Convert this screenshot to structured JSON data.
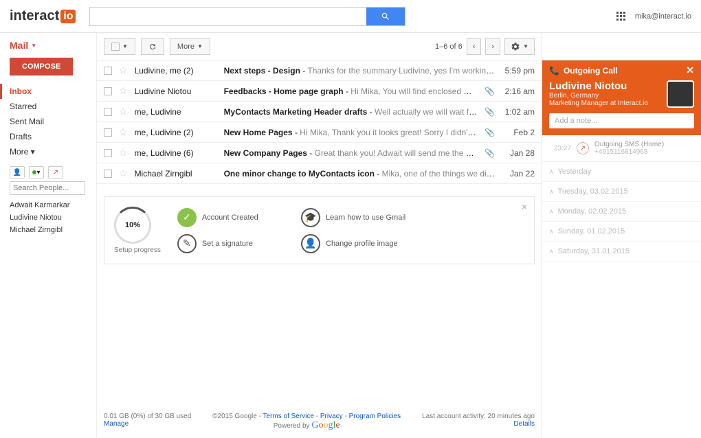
{
  "logo": {
    "prefix": "interact",
    "suffix": "io"
  },
  "user_email": "mika@interact.io",
  "mail_label": "Mail",
  "compose": "COMPOSE",
  "nav": [
    {
      "label": "Inbox",
      "active": true
    },
    {
      "label": "Starred"
    },
    {
      "label": "Sent Mail"
    },
    {
      "label": "Drafts"
    },
    {
      "label": "More"
    }
  ],
  "search_people_placeholder": "Search People...",
  "people": [
    "Adwait Karmarkar",
    "Ludivine Niotou",
    "Michael Zirngibl"
  ],
  "toolbar": {
    "more": "More"
  },
  "page_info": "1–6 of 6",
  "emails": [
    {
      "sender": "Ludivine, me (2)",
      "subject": "Next steps - Design",
      "preview": "Thanks for the summary Ludivine, yes I'm working on the n",
      "time": "5:59 pm"
    },
    {
      "sender": "Ludivine Niotou",
      "subject": "Feedbacks - Home page graph",
      "preview": "Hi Mika, You will find enclosed Michael feedbac",
      "time": "2:16 am",
      "attach": true
    },
    {
      "sender": "me, Ludivine",
      "subject": "MyContacts Marketing Header drafts",
      "preview": "Well actually we will wait for you to finish it",
      "time": "1:02 am",
      "attach": true
    },
    {
      "sender": "me, Ludivine (2)",
      "subject": "New Home Pages",
      "preview": "Hi Mika, Thank you it looks great! Sorry I didn't answer befor",
      "time": "Feb 2",
      "attach": true
    },
    {
      "sender": "me, Ludivine (6)",
      "subject": "New Company Pages",
      "preview": "Great thank you! Adwait will send me the website with all",
      "time": "Jan 28",
      "attach": true
    },
    {
      "sender": "Michael Zirngibl",
      "subject": "One minor change to MyContacts icon",
      "preview": "Mika, one of the things we did in the orig",
      "time": "Jan 22"
    }
  ],
  "onboard": {
    "progress": "10%",
    "progress_label": "Setup progress",
    "items": [
      {
        "icon": "check",
        "label": "Account Created",
        "done": true
      },
      {
        "icon": "grad",
        "label": "Learn how to use Gmail"
      },
      {
        "icon": "pen",
        "label": "Set a signature"
      },
      {
        "icon": "person",
        "label": "Change profile image"
      }
    ]
  },
  "footer": {
    "storage": "0.01 GB (0%) of 30 GB used",
    "manage": "Manage",
    "copyright": "©2015 Google",
    "tos": "Terms of Service",
    "privacy": "Privacy",
    "program": "Program Policies",
    "powered": "Powered by",
    "activity": "Last account activity: 20 minutes ago",
    "details": "Details"
  },
  "panel": {
    "title": "Outgoing Call",
    "name": "Ludivine Niotou",
    "location": "Berlin, Germany",
    "role": "Marketing Manager at Interact.io",
    "note_placeholder": "Add a note...",
    "activity": {
      "time": "23:27",
      "label": "Outgoing SMS (Home)",
      "number": "+4915116814968"
    },
    "days": [
      "Yesterday",
      "Tuesday, 03.02.2015",
      "Monday, 02.02.2015",
      "Sunday, 01.02.2015",
      "Saturday, 31.01.2015"
    ]
  }
}
